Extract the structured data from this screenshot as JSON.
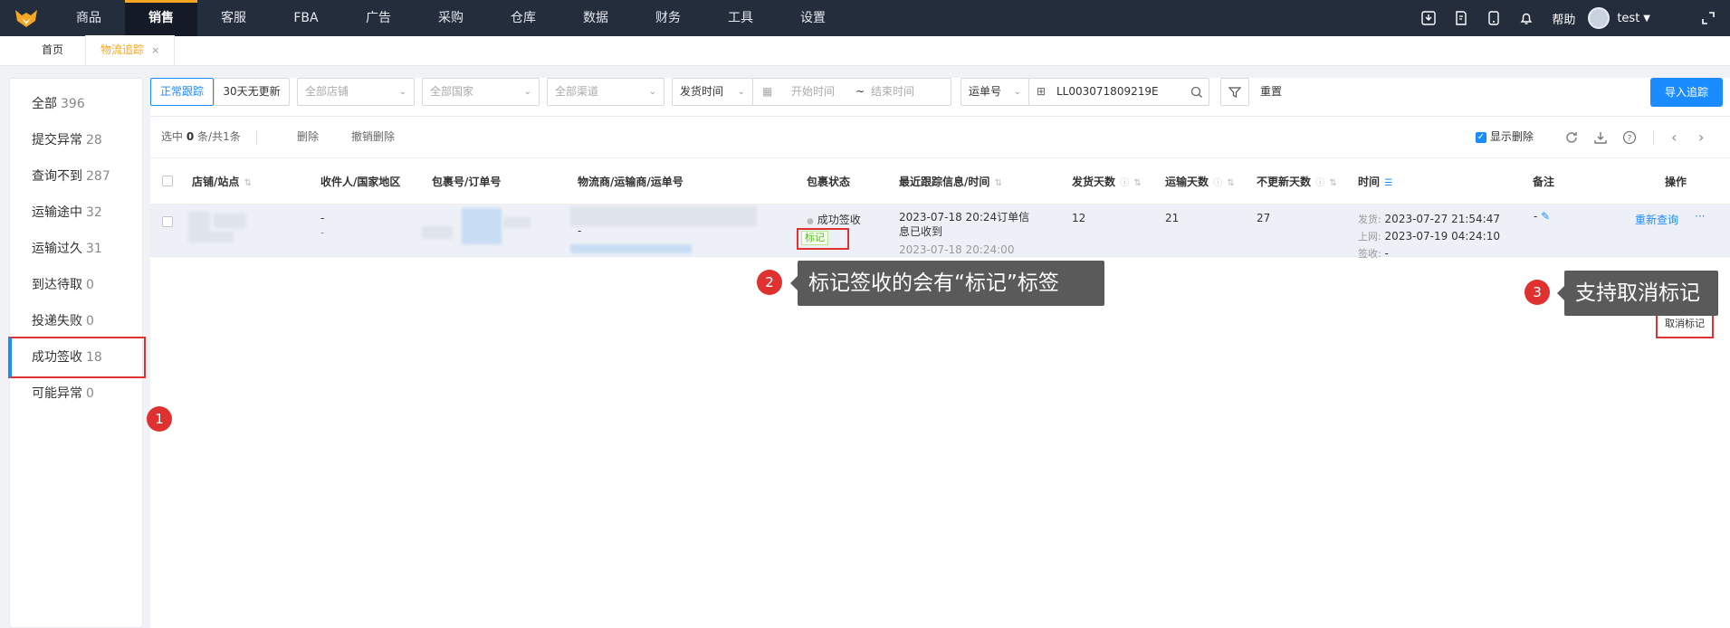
{
  "nav": {
    "items": [
      "商品",
      "销售",
      "客服",
      "FBA",
      "广告",
      "采购",
      "仓库",
      "数据",
      "财务",
      "工具",
      "设置"
    ],
    "active_index": 1,
    "help": "帮助",
    "user": "test"
  },
  "tabs": {
    "home": "首页",
    "current": "物流追踪",
    "close": "×"
  },
  "status_list": [
    {
      "label": "全部",
      "count": "396"
    },
    {
      "label": "提交异常",
      "count": "28"
    },
    {
      "label": "查询不到",
      "count": "287"
    },
    {
      "label": "运输途中",
      "count": "32"
    },
    {
      "label": "运输过久",
      "count": "31"
    },
    {
      "label": "到达待取",
      "count": "0"
    },
    {
      "label": "投递失败",
      "count": "0"
    },
    {
      "label": "成功签收",
      "count": "18"
    },
    {
      "label": "可能异常",
      "count": "0"
    }
  ],
  "filters": {
    "seg_normal": "正常跟踪",
    "seg_30days": "30天无更新",
    "store": "全部店铺",
    "country": "全部国家",
    "channel": "全部渠道",
    "time_type": "发货时间",
    "start": "开始时间",
    "sep": "~",
    "end": "结束时间",
    "search_type": "运单号",
    "search_value": "LL003071809219E",
    "reset": "重置",
    "import": "导入追踪"
  },
  "toolbar": {
    "selected_prefix": "选中",
    "selected_count": "0",
    "selected_suffix": "条/共1条",
    "delete": "删除",
    "undo_delete": "撤销删除",
    "show_deleted": "显示删除"
  },
  "columns": [
    "店铺/站点",
    "收件人/国家地区",
    "包裹号/订单号",
    "物流商/运输商/运单号",
    "包裹状态",
    "最近跟踪信息/时间",
    "发货天数",
    "运输天数",
    "不更新天数",
    "时间",
    "备注",
    "操作"
  ],
  "row": {
    "recipient": "-",
    "recipient_country": "-",
    "carrier_dash": "-",
    "status": "成功签收",
    "status_tag": "标记",
    "track_info": "2023-07-18 20:24订单信息已收到",
    "track_time": "2023-07-18 20:24:00",
    "ship_days": "12",
    "transit_days": "21",
    "no_update_days": "27",
    "time_ship_label": "发货:",
    "time_ship": "2023-07-27 21:54:47",
    "time_online_label": "上网:",
    "time_online": "2023-07-19 04:24:10",
    "time_sign_label": "签收:",
    "time_sign": "-",
    "remark": "-",
    "requery": "重新查询",
    "more": "···",
    "cancel_mark": "取消标记"
  },
  "callouts": [
    {
      "num": "1"
    },
    {
      "num": "2",
      "text": "标记签收的会有“标记”标签"
    },
    {
      "num": "3",
      "text": "支持取消标记"
    }
  ],
  "colors": {
    "accent": "#1a8cff",
    "nav_bg": "#232d3c",
    "highlight": "#e03131",
    "brand": "#f5a623"
  }
}
